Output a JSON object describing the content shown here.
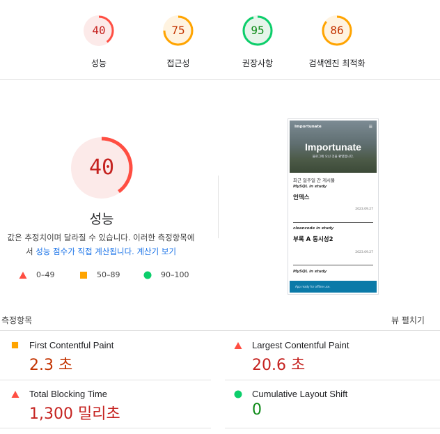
{
  "colors": {
    "fail": "#ff4e42",
    "average": "#ffa400",
    "pass": "#0cce6b",
    "fail_text": "#c5221f",
    "average_text": "#c33300",
    "pass_text": "#0d8a17",
    "fail_bg": "#fceae9",
    "average_bg": "#fff3e0",
    "pass_bg": "#e6f4ea"
  },
  "scores": [
    {
      "value": "40",
      "label": "성능",
      "fraction": 0.4,
      "rating": "fail"
    },
    {
      "value": "75",
      "label": "접근성",
      "fraction": 0.75,
      "rating": "average"
    },
    {
      "value": "95",
      "label": "권장사항",
      "fraction": 0.95,
      "rating": "pass"
    },
    {
      "value": "86",
      "label": "검색엔진 최적화",
      "fraction": 0.86,
      "rating": "average"
    }
  ],
  "main": {
    "score": "40",
    "fraction": 0.4,
    "title": "성능",
    "desc_line1": "값은 추정치이며 달라질 수 있습니다. 이러한 측정항목에",
    "desc_line2_pre": "서",
    "desc_link1": "성능 점수가 직접 계산됩니다.",
    "desc_link2": "계산기 보기"
  },
  "legend": [
    {
      "icon": "triangle-icon",
      "label": "0–49"
    },
    {
      "icon": "square-icon",
      "label": "50–89"
    },
    {
      "icon": "circle-icon",
      "label": "90–100"
    }
  ],
  "screenshot": {
    "brand": "Importunate",
    "menu_icon": "hamburger-icon",
    "hero_title": "Importunate",
    "hero_subtitle": "블로그에 오신 것을 환영합니다.",
    "recent_heading": "최근 일주일 간 게시물",
    "posts": [
      {
        "category": "MySQL in study",
        "title": "인덱스",
        "date": "2023.09.27"
      },
      {
        "category": "cleancode in study",
        "title": "부록 A 동시성2",
        "date": "2023.09.27"
      },
      {
        "category": "MySQL in study",
        "title": "",
        "date": ""
      }
    ],
    "footer_text": "App ready for offline use."
  },
  "metrics_section": {
    "title": "측정항목",
    "expand_label": "뷰 펼치기"
  },
  "metrics": [
    {
      "name": "First Contentful Paint",
      "value": "2.3 초",
      "rating": "average",
      "icon": "square-icon"
    },
    {
      "name": "Largest Contentful Paint",
      "value": "20.6 초",
      "rating": "fail",
      "icon": "triangle-icon"
    },
    {
      "name": "Total Blocking Time",
      "value": "1,300 밀리초",
      "rating": "fail",
      "icon": "triangle-icon"
    },
    {
      "name": "Cumulative Layout Shift",
      "value": "0",
      "rating": "pass",
      "icon": "circle-icon"
    }
  ]
}
